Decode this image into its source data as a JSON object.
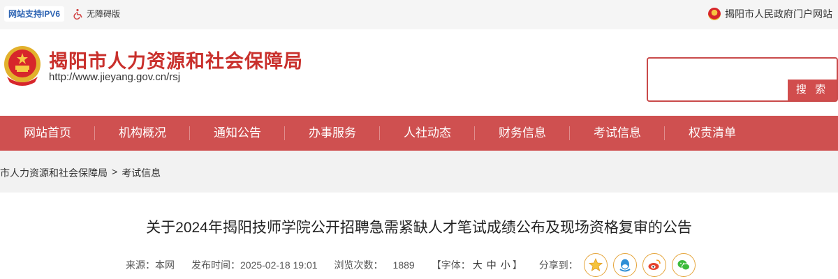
{
  "topbar": {
    "ipv6_label": "网站支持IPV6",
    "accessibility_label": "无障碍版",
    "portal_label": "揭阳市人民政府门户网站"
  },
  "header": {
    "title": "揭阳市人力资源和社会保障局",
    "url": "http://www.jieyang.gov.cn/rsj"
  },
  "search": {
    "placeholder": "",
    "button_label": "搜 索"
  },
  "nav": {
    "items": [
      "网站首页",
      "机构概况",
      "通知公告",
      "办事服务",
      "人社动态",
      "财务信息",
      "考试信息",
      "权责清单"
    ]
  },
  "breadcrumb": {
    "home": "市人力资源和社会保障局",
    "separator": ">",
    "current": "考试信息"
  },
  "article": {
    "title": "关于2024年揭阳技师学院公开招聘急需紧缺人才笔试成绩公布及现场资格复审的公告",
    "source": "来源：本网",
    "published": "发布时间：2025-02-18 19:01",
    "views_label": "浏览次数：",
    "views": "1889",
    "font_label": "【字体：",
    "font_large": "大",
    "font_medium": "中",
    "font_small": "小",
    "font_close": "】",
    "share_label": "分享到："
  },
  "colors": {
    "brand_red": "#cf5050",
    "title_red": "#c9302c",
    "ipv6_blue": "#2d64b3"
  },
  "icons": {
    "share": [
      "qzone-icon",
      "qq-icon",
      "weibo-icon",
      "wechat-icon"
    ]
  }
}
